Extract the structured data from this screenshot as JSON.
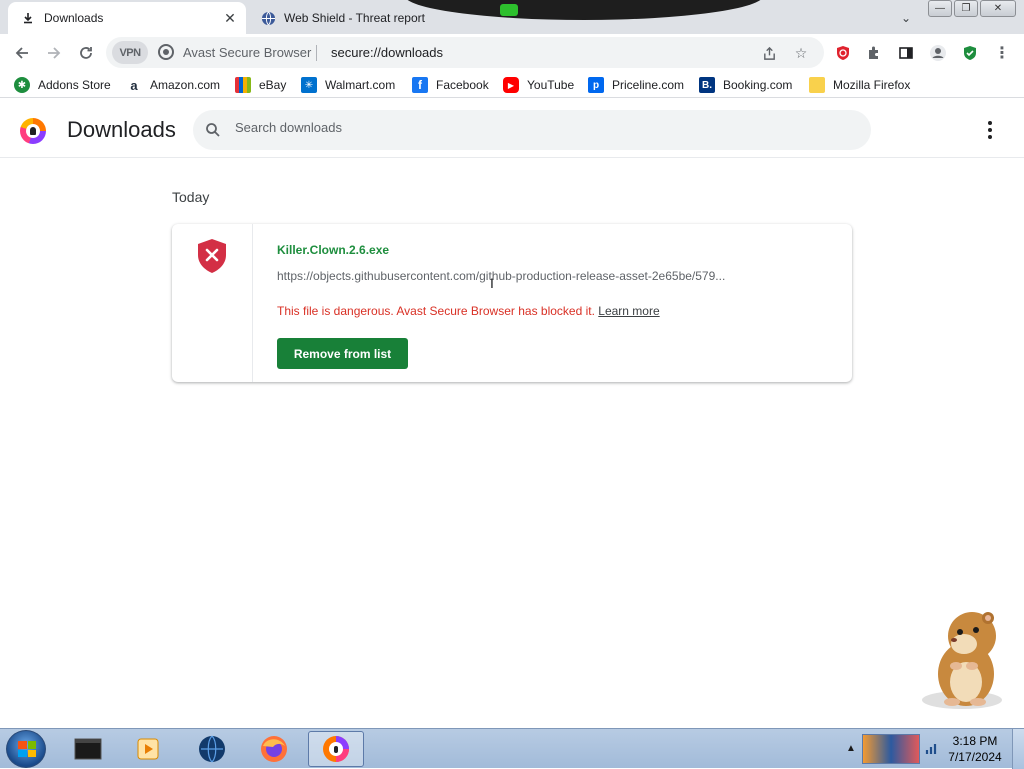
{
  "tabs": [
    {
      "title": "Downloads",
      "icon": "download-icon",
      "active": true
    },
    {
      "title": "Web Shield - Threat report",
      "icon": "globe-icon",
      "active": false
    }
  ],
  "toolbar": {
    "vpn_label": "VPN",
    "brand": "Avast Secure Browser",
    "url": "secure://downloads"
  },
  "bookmarks": [
    {
      "label": "Addons Store",
      "icon": "addons-store-icon",
      "color": "#1e8e3e"
    },
    {
      "label": "Amazon.com",
      "icon": "amazon-icon",
      "color": "#232f3e"
    },
    {
      "label": "eBay",
      "icon": "ebay-icon",
      "color": "#e53238"
    },
    {
      "label": "Walmart.com",
      "icon": "walmart-icon",
      "color": "#0071ce"
    },
    {
      "label": "Facebook",
      "icon": "facebook-icon",
      "color": "#1877f2"
    },
    {
      "label": "YouTube",
      "icon": "youtube-icon",
      "color": "#ff0000"
    },
    {
      "label": "Priceline.com",
      "icon": "priceline-icon",
      "color": "#0068ef"
    },
    {
      "label": "Booking.com",
      "icon": "booking-icon",
      "color": "#003580"
    },
    {
      "label": "Mozilla Firefox",
      "icon": "folder-icon",
      "color": "#f9d14c"
    }
  ],
  "downloads_page": {
    "title": "Downloads",
    "search_placeholder": "Search downloads",
    "date_heading": "Today",
    "item": {
      "file_name": "Killer.Clown.2.6.exe",
      "url": "https://objects.githubusercontent.com/github-production-release-asset-2e65be/579...",
      "danger_message": "This file is dangerous. Avast Secure Browser has blocked it.",
      "learn_more": "Learn more",
      "remove_button": "Remove from list",
      "status_icon": "danger-shield-icon"
    }
  },
  "taskbar": {
    "items": [
      "command-prompt-icon",
      "media-player-icon",
      "globe-app-icon",
      "firefox-icon",
      "avast-browser-icon"
    ],
    "active_item": "avast-browser-icon",
    "clock_time": "3:18 PM",
    "clock_date": "7/17/2024"
  },
  "colors": {
    "danger": "#d93025",
    "file_name": "#1e8e3e",
    "remove_button": "#188038",
    "taskbar": "#a8bfdc"
  }
}
